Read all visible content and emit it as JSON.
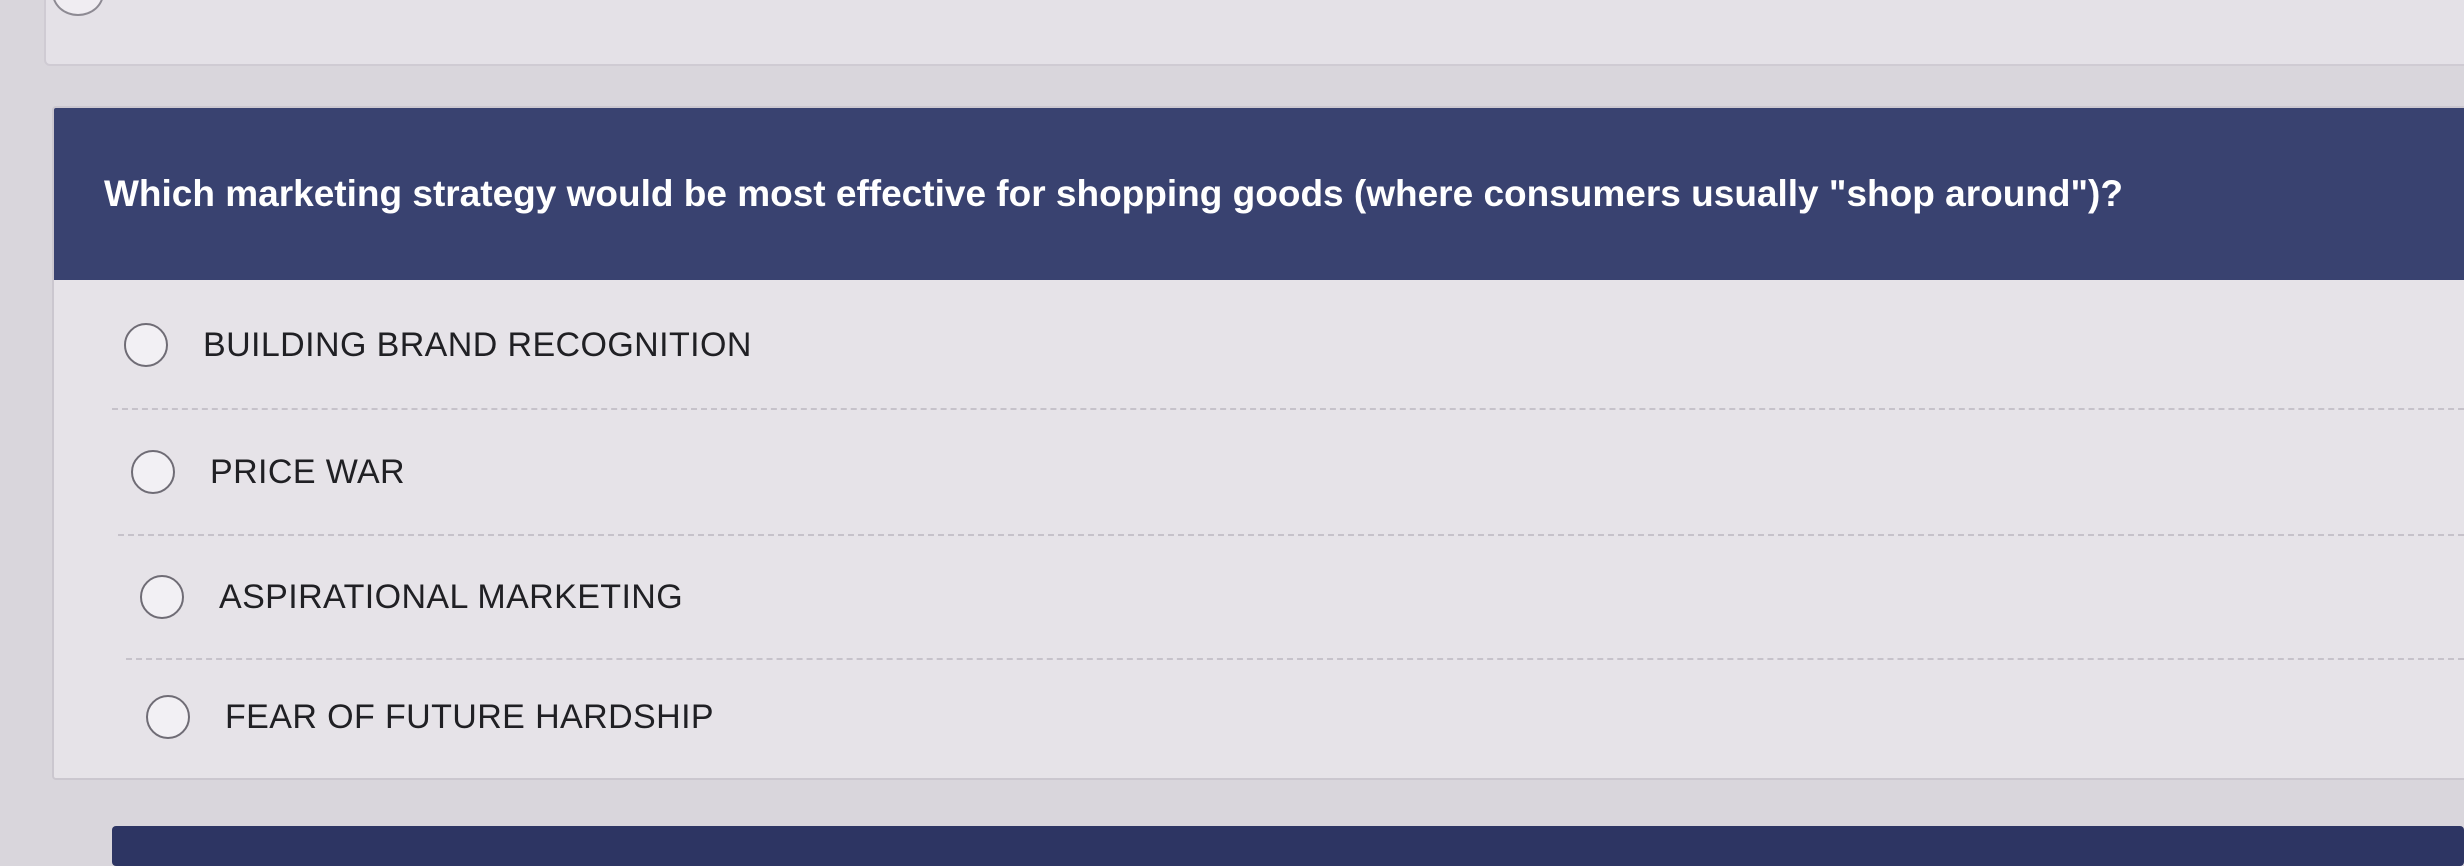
{
  "question": {
    "text": "Which marketing strategy would be most effective for shopping goods (where consumers usually \"shop around\")?",
    "options": [
      {
        "label": "BUILDING BRAND RECOGNITION",
        "selected": false
      },
      {
        "label": "PRICE WAR",
        "selected": false
      },
      {
        "label": "ASPIRATIONAL MARKETING",
        "selected": false
      },
      {
        "label": "FEAR OF FUTURE HARDSHIP",
        "selected": false
      }
    ]
  },
  "colors": {
    "question_bar": "#394270",
    "page_background": "#d9d6dc",
    "card_background": "#e6e3e8"
  }
}
